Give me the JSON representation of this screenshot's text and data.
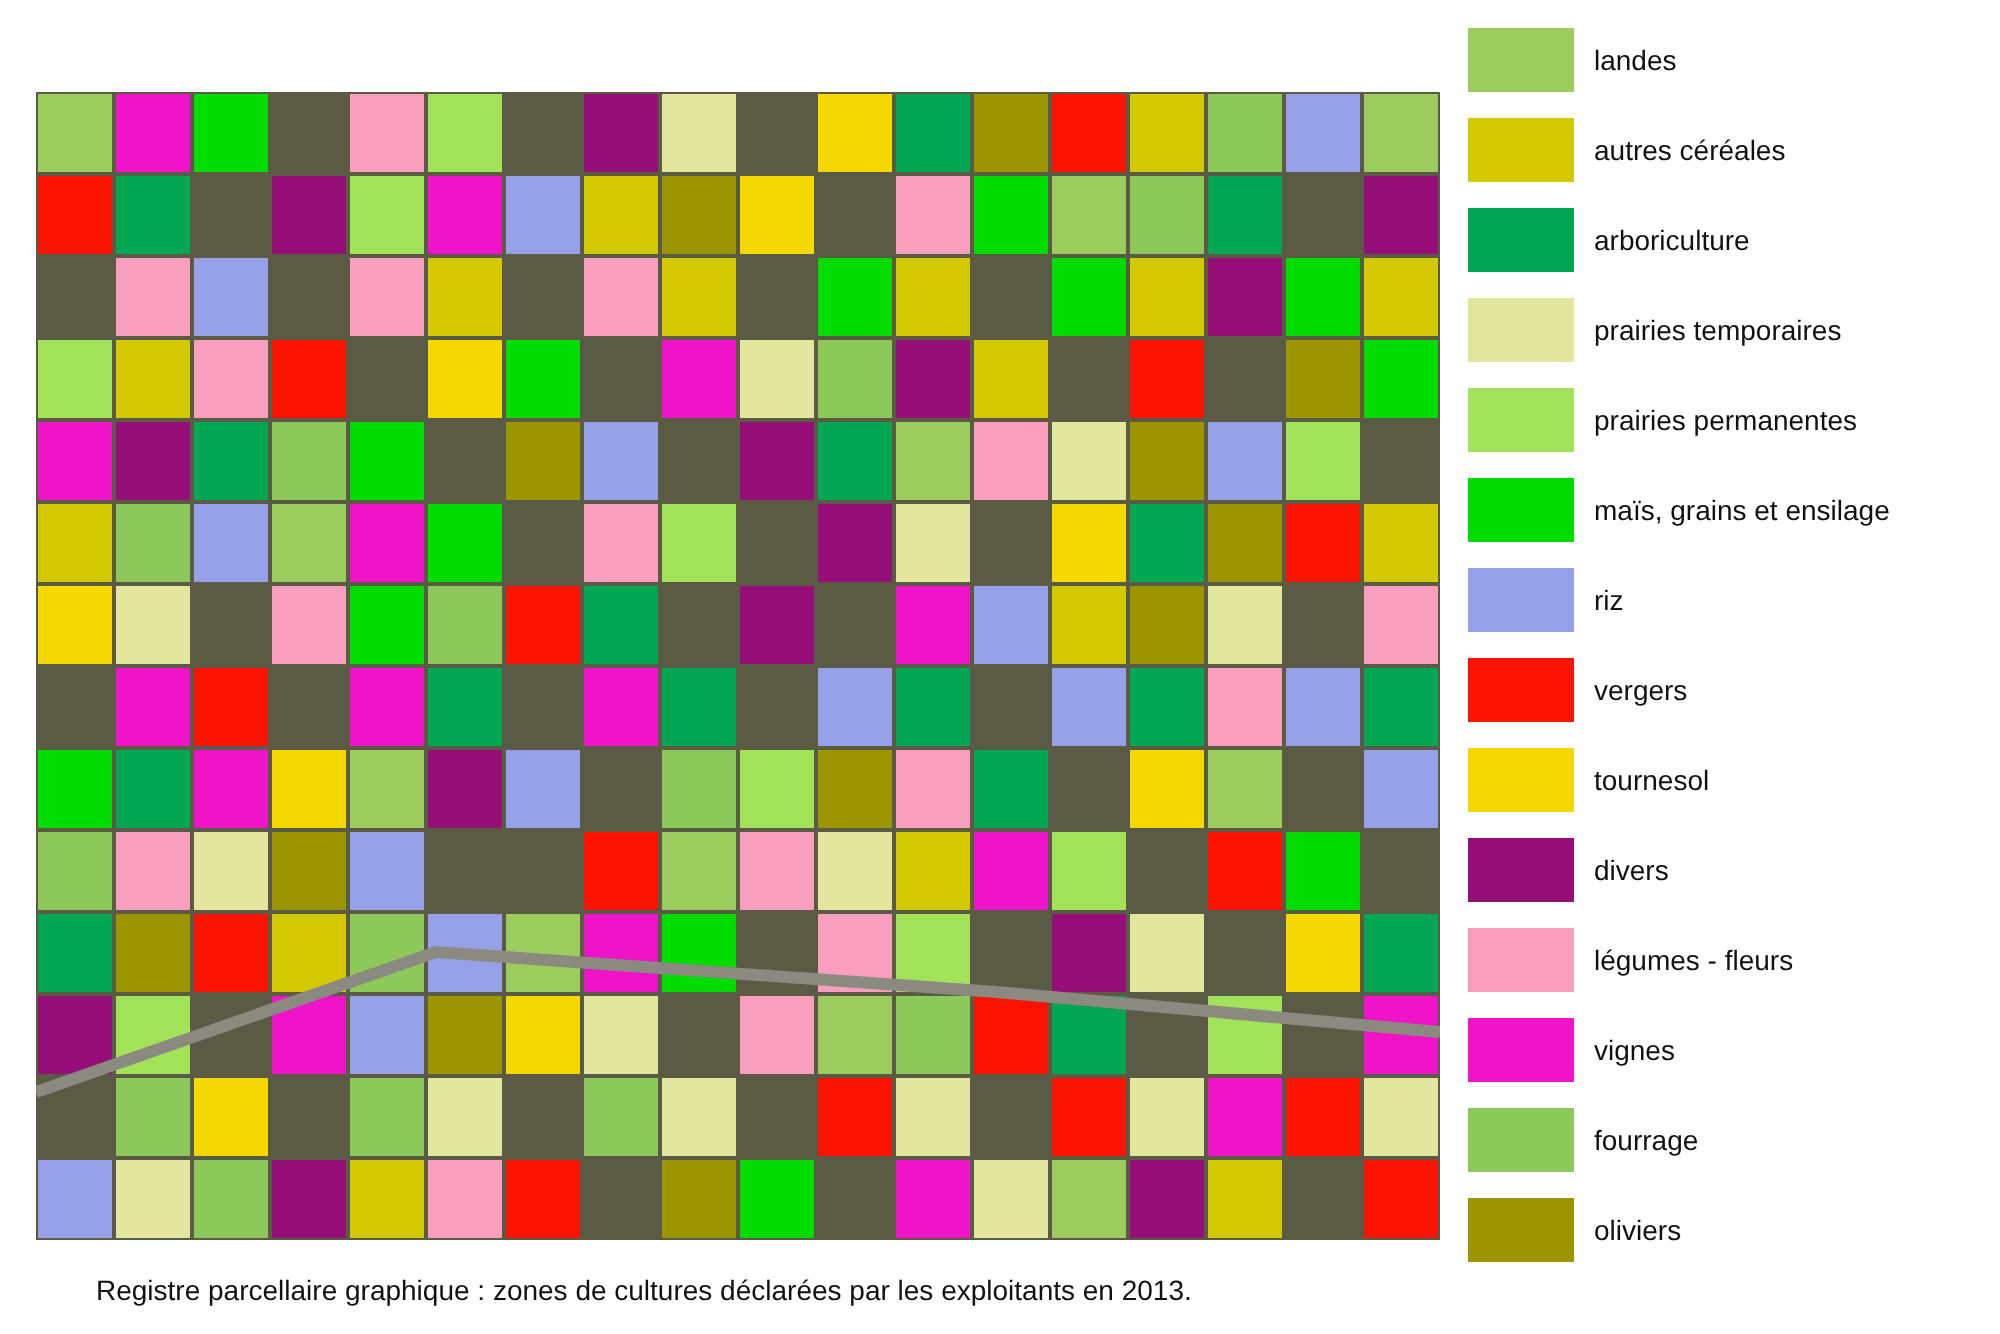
{
  "legend": [
    {
      "label": "landes",
      "color": "#9ccc5e"
    },
    {
      "label": "autres céréales",
      "color": "#d4c800"
    },
    {
      "label": "arboriculture",
      "color": "#00a651"
    },
    {
      "label": "prairies temporaires",
      "color": "#e2e69c"
    },
    {
      "label": "prairies permanentes",
      "color": "#a3e35a"
    },
    {
      "label": "maïs, grains et ensilage",
      "color": "#00dc00"
    },
    {
      "label": "riz",
      "color": "#96a0e6"
    },
    {
      "label": "vergers",
      "color": "#fa1400"
    },
    {
      "label": "tournesol",
      "color": "#f5d800"
    },
    {
      "label": "divers",
      "color": "#960f78"
    },
    {
      "label": "légumes - fleurs",
      "color": "#fa9ebe"
    },
    {
      "label": "vignes",
      "color": "#f014c8"
    },
    {
      "label": "fourrage",
      "color": "#8cc85a"
    },
    {
      "label": "oliviers",
      "color": "#9b9600"
    }
  ],
  "caption": "Registre parcellaire graphique : zones de cultures déclarées par les exploitants en 2013."
}
